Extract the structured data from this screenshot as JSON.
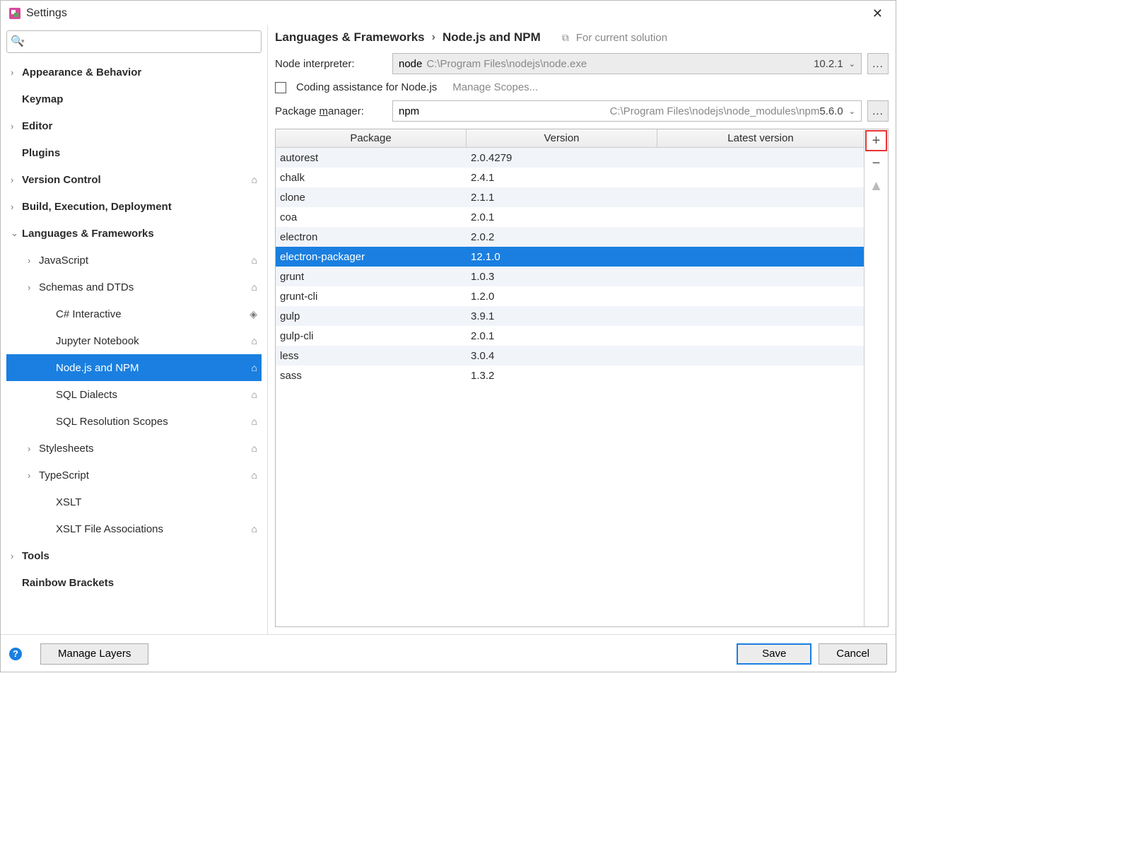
{
  "window": {
    "title": "Settings"
  },
  "search": {
    "placeholder": ""
  },
  "tree": [
    {
      "label": "Appearance & Behavior",
      "bold": true,
      "arrow": "›",
      "badge": ""
    },
    {
      "label": "Keymap",
      "bold": true,
      "arrow": "",
      "badge": ""
    },
    {
      "label": "Editor",
      "bold": true,
      "arrow": "›",
      "badge": ""
    },
    {
      "label": "Plugins",
      "bold": true,
      "arrow": "",
      "badge": ""
    },
    {
      "label": "Version Control",
      "bold": true,
      "arrow": "›",
      "badge": "⌂"
    },
    {
      "label": "Build, Execution, Deployment",
      "bold": true,
      "arrow": "›",
      "badge": ""
    },
    {
      "label": "Languages & Frameworks",
      "bold": true,
      "arrow": "⌄",
      "badge": ""
    },
    {
      "label": "JavaScript",
      "bold": false,
      "arrow": "›",
      "badge": "⌂",
      "indent": 1
    },
    {
      "label": "Schemas and DTDs",
      "bold": false,
      "arrow": "›",
      "badge": "⌂",
      "indent": 1
    },
    {
      "label": "C# Interactive",
      "bold": false,
      "arrow": "",
      "badge": "◈",
      "indent": 2
    },
    {
      "label": "Jupyter Notebook",
      "bold": false,
      "arrow": "",
      "badge": "⌂",
      "indent": 2
    },
    {
      "label": "Node.js and NPM",
      "bold": false,
      "arrow": "",
      "badge": "⌂",
      "indent": 2,
      "selected": true
    },
    {
      "label": "SQL Dialects",
      "bold": false,
      "arrow": "",
      "badge": "⌂",
      "indent": 2
    },
    {
      "label": "SQL Resolution Scopes",
      "bold": false,
      "arrow": "",
      "badge": "⌂",
      "indent": 2
    },
    {
      "label": "Stylesheets",
      "bold": false,
      "arrow": "›",
      "badge": "⌂",
      "indent": 1
    },
    {
      "label": "TypeScript",
      "bold": false,
      "arrow": "›",
      "badge": "⌂",
      "indent": 1
    },
    {
      "label": "XSLT",
      "bold": false,
      "arrow": "",
      "badge": "",
      "indent": 2
    },
    {
      "label": "XSLT File Associations",
      "bold": false,
      "arrow": "",
      "badge": "⌂",
      "indent": 2
    },
    {
      "label": "Tools",
      "bold": true,
      "arrow": "›",
      "badge": ""
    },
    {
      "label": "Rainbow Brackets",
      "bold": true,
      "arrow": "",
      "badge": ""
    }
  ],
  "breadcrumb": {
    "a": "Languages & Frameworks",
    "b": "Node.js and NPM",
    "scope": "For current solution"
  },
  "interpreter": {
    "label": "Node interpreter:",
    "value": "node",
    "path": "C:\\Program Files\\nodejs\\node.exe",
    "version": "10.2.1"
  },
  "coding": {
    "label": "Coding assistance for Node.js",
    "manage": "Manage Scopes..."
  },
  "packager": {
    "label_pre": "Package ",
    "label_u": "m",
    "label_post": "anager:",
    "value": "npm",
    "path": "C:\\Program Files\\nodejs\\node_modules\\npm",
    "version": "5.6.0"
  },
  "table": {
    "headers": {
      "c1": "Package",
      "c2": "Version",
      "c3": "Latest version"
    },
    "rows": [
      {
        "name": "autorest",
        "version": "2.0.4279",
        "latest": ""
      },
      {
        "name": "chalk",
        "version": "2.4.1",
        "latest": ""
      },
      {
        "name": "clone",
        "version": "2.1.1",
        "latest": ""
      },
      {
        "name": "coa",
        "version": "2.0.1",
        "latest": ""
      },
      {
        "name": "electron",
        "version": "2.0.2",
        "latest": ""
      },
      {
        "name": "electron-packager",
        "version": "12.1.0",
        "latest": "",
        "selected": true
      },
      {
        "name": "grunt",
        "version": "1.0.3",
        "latest": ""
      },
      {
        "name": "grunt-cli",
        "version": "1.2.0",
        "latest": ""
      },
      {
        "name": "gulp",
        "version": "3.9.1",
        "latest": ""
      },
      {
        "name": "gulp-cli",
        "version": "2.0.1",
        "latest": ""
      },
      {
        "name": "less",
        "version": "3.0.4",
        "latest": ""
      },
      {
        "name": "sass",
        "version": "1.3.2",
        "latest": ""
      }
    ]
  },
  "footer": {
    "manage": "Manage Layers",
    "save": "Save",
    "cancel": "Cancel"
  }
}
